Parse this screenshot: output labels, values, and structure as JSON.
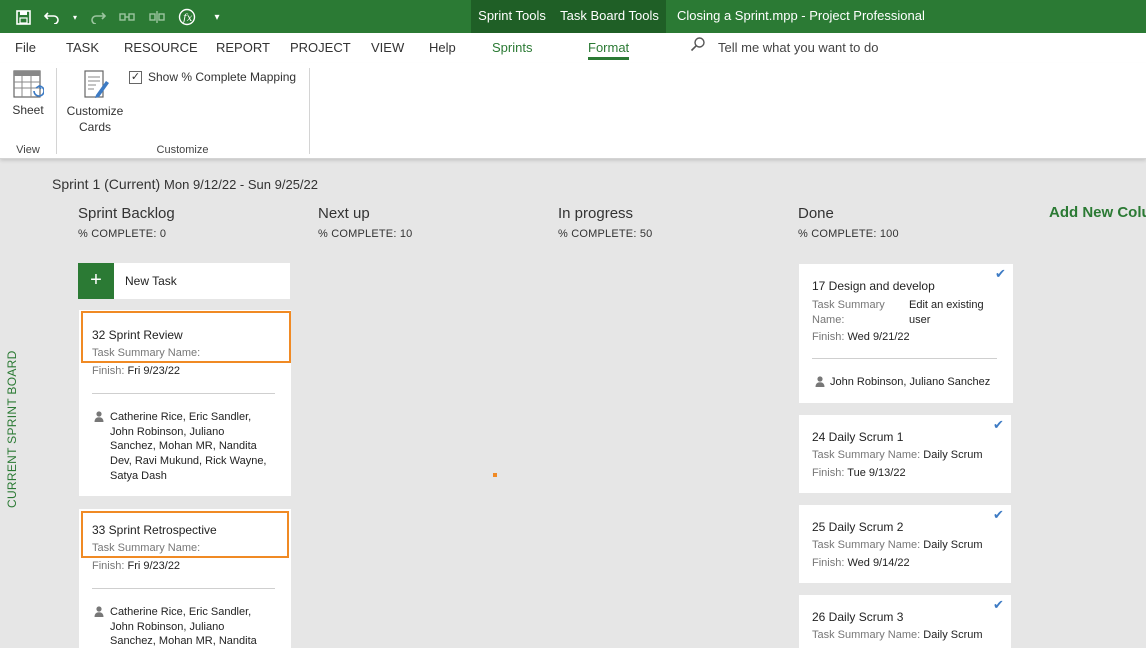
{
  "titlebar": {
    "context_tabs": [
      "Sprint Tools",
      "Task Board Tools"
    ],
    "doc_title": "Closing a Sprint.mpp  -  Project Professional",
    "icons": [
      "save-icon",
      "undo-icon",
      "redo-icon",
      "link-icon",
      "unlink-icon",
      "formula-icon",
      "customize-qat-icon"
    ]
  },
  "ribbon_tabs": {
    "file": "File",
    "task": "TASK",
    "resource": "RESOURCE",
    "report": "REPORT",
    "project": "PROJECT",
    "view": "VIEW",
    "help": "Help",
    "sprints": "Sprints",
    "format": "Format",
    "tell_me": "Tell me what you want to do"
  },
  "ribbon": {
    "sheet_label": "Sheet",
    "view_group": "View",
    "customize_cards_line1": "Customize",
    "customize_cards_line2": "Cards",
    "show_complete_mapping": "Show % Complete Mapping",
    "show_complete_mapping_checked": true,
    "customize_group": "Customize"
  },
  "board": {
    "sidebar_label": "CURRENT SPRINT BOARD",
    "sprint_name": "Sprint 1 (Current)",
    "sprint_dates": "Mon 9/12/22 - Sun 9/25/22",
    "add_column": "Add New Column",
    "new_task": "New Task",
    "columns": [
      {
        "title": "Sprint Backlog",
        "pct": "% COMPLETE: 0"
      },
      {
        "title": "Next up",
        "pct": "% COMPLETE: 10"
      },
      {
        "title": "In progress",
        "pct": "% COMPLETE: 50"
      },
      {
        "title": "Done",
        "pct": "% COMPLETE: 100"
      }
    ],
    "labels": {
      "task_summary": "Task Summary Name:",
      "task_summary_line1": "Task Summary",
      "task_summary_line2": "Name:",
      "finish": "Finish:"
    },
    "backlog_cards": [
      {
        "title": "32  Sprint Review",
        "finish": "Fri 9/23/22",
        "assignees": [
          "Catherine Rice, Eric Sandler,",
          "John Robinson, Juliano",
          "Sanchez, Mohan MR, Nandita",
          "Dev, Ravi Mukund, Rick Wayne,",
          "Satya Dash"
        ]
      },
      {
        "title": "33  Sprint Retrospective",
        "finish": "Fri 9/23/22",
        "assignees": [
          "Catherine Rice, Eric Sandler,",
          "John Robinson, Juliano",
          "Sanchez, Mohan MR, Nandita"
        ]
      }
    ],
    "done_cards": [
      {
        "title": "17  Design and develop",
        "summary_line1": "Edit an existing",
        "summary_line2": "user",
        "finish": "Wed 9/21/22",
        "assignees": "John Robinson, Juliano Sanchez"
      },
      {
        "title": "24  Daily Scrum 1",
        "summary": "Daily Scrum",
        "finish": "Tue 9/13/22"
      },
      {
        "title": "25  Daily Scrum 2",
        "summary": "Daily Scrum",
        "finish": "Wed 9/14/22"
      },
      {
        "title": "26  Daily Scrum 3",
        "summary": "Daily Scrum"
      }
    ]
  }
}
